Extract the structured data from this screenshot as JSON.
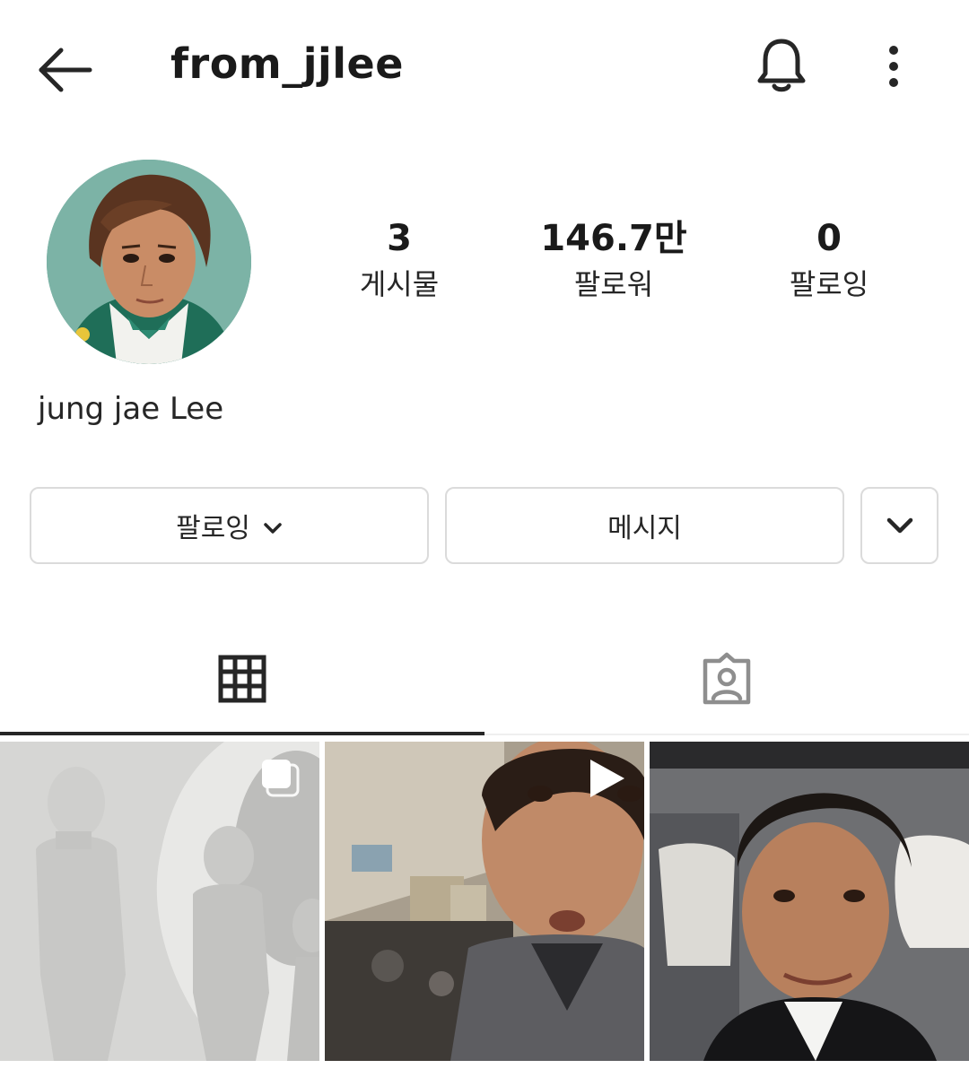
{
  "header": {
    "username": "from_jjlee",
    "icons": [
      "back-arrow-icon",
      "bell-icon",
      "more-vertical-icon"
    ]
  },
  "profile": {
    "full_name": "jung jae Lee",
    "stats": {
      "posts": {
        "value": "3",
        "label": "게시물"
      },
      "followers": {
        "value": "146.7만",
        "label": "팔로워"
      },
      "following": {
        "value": "0",
        "label": "팔로잉"
      }
    }
  },
  "actions": {
    "follow_label": "팔로잉",
    "message_label": "메시지"
  },
  "tabs": [
    {
      "name": "grid",
      "icon": "grid-icon",
      "active": true
    },
    {
      "name": "tagged",
      "icon": "tagged-person-icon",
      "active": false
    }
  ],
  "posts": [
    {
      "type": "carousel",
      "badge_icon": "carousel-icon"
    },
    {
      "type": "video",
      "badge_icon": "play-icon"
    },
    {
      "type": "photo"
    }
  ],
  "colors": {
    "text": "#262626",
    "border": "#dbdbdb",
    "background": "#ffffff"
  }
}
